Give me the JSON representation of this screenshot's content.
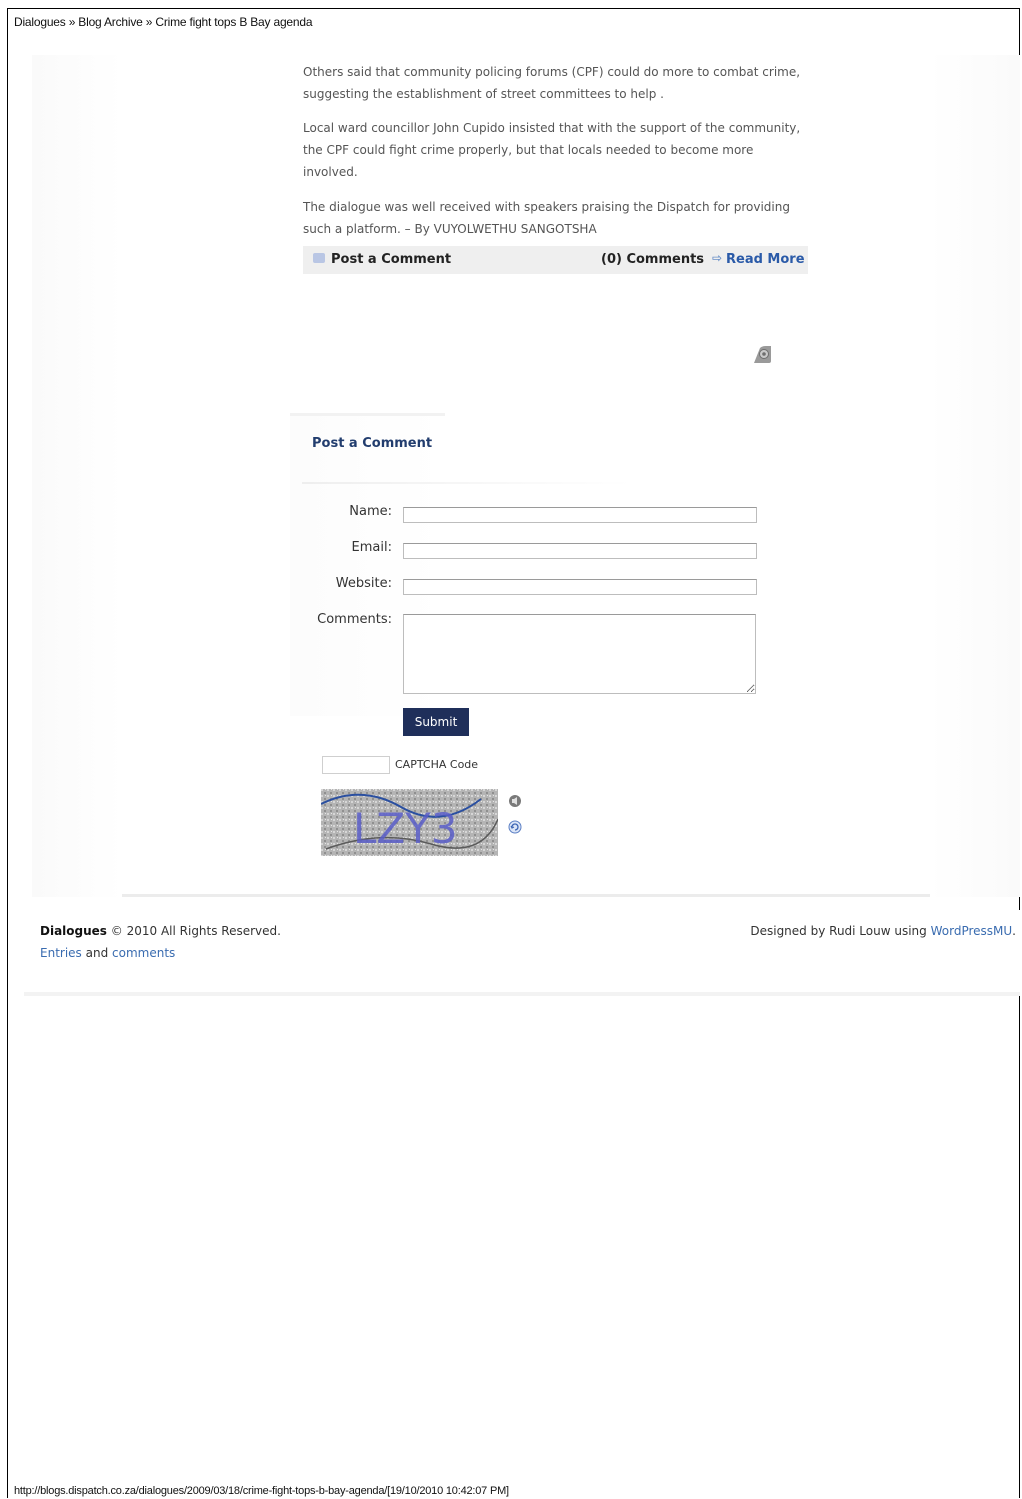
{
  "print_header": "Dialogues » Blog Archive » Crime fight tops B Bay agenda",
  "print_footer": "http://blogs.dispatch.co.za/dialogues/2009/03/18/crime-fight-tops-b-bay-agenda/[19/10/2010 10:42:07 PM]",
  "article": {
    "paragraphs": [
      "Others said that community policing forums (CPF) could do more to combat crime, suggesting the establishment of street committees to help .",
      "Local ward councillor John Cupido insisted that with the support of the community, the CPF could fight crime properly, but that locals needed to become more involved.",
      "The dialogue was well received with speakers praising the Dispatch for providing such a platform.  – By VUYOLWETHU SANGOTSHA"
    ]
  },
  "comment_bar": {
    "post_comment": "Post a Comment",
    "comments_count": "(0) Comments",
    "read_more": "Read More"
  },
  "form": {
    "title": "Post a Comment",
    "name_label": "Name:",
    "email_label": "Email:",
    "website_label": "Website:",
    "comments_label": "Comments:",
    "submit_label": "Submit",
    "captcha_label": "CAPTCHA Code",
    "captcha_text": "LZY3"
  },
  "footer": {
    "site_name": "Dialogues",
    "copyright": "© 2010 All Rights Reserved.",
    "entries": "Entries",
    "and": "and",
    "comments": "comments",
    "designed_by": "Designed by Rudi Louw using",
    "wordpress": "WordPressMU",
    "period": "."
  },
  "colors": {
    "submit_bg": "#1f2f5a",
    "link": "#3a6cb0",
    "form_title": "#223d6e"
  }
}
